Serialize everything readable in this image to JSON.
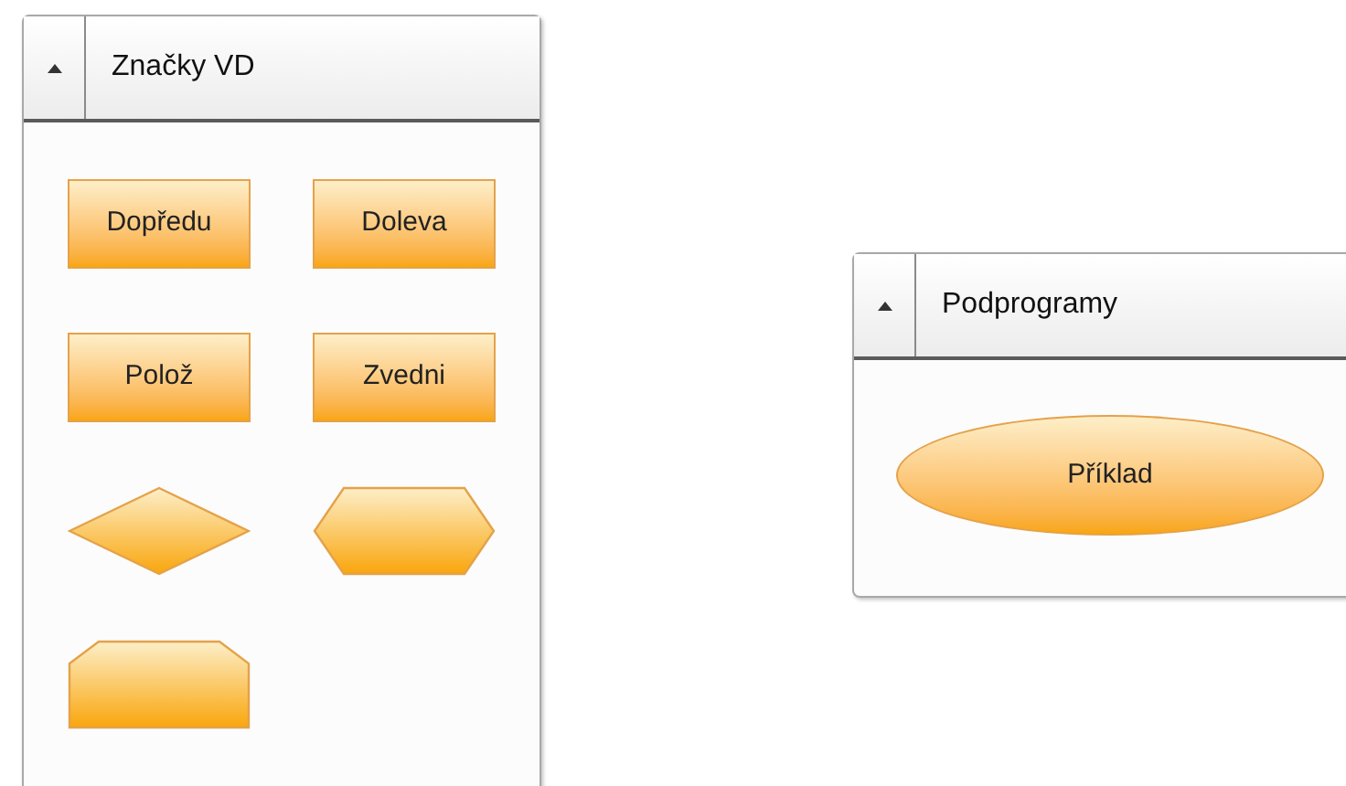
{
  "palettes": [
    {
      "title": "Značky VD",
      "expanded": true,
      "items": [
        {
          "kind": "rect",
          "label": "Dopředu"
        },
        {
          "kind": "rect",
          "label": "Doleva"
        },
        {
          "kind": "rect",
          "label": "Polož"
        },
        {
          "kind": "rect",
          "label": "Zvedni"
        },
        {
          "kind": "diamond"
        },
        {
          "kind": "hexagon"
        },
        {
          "kind": "tab"
        }
      ]
    },
    {
      "title": "Podprogramy",
      "expanded": true,
      "items": [
        {
          "kind": "ellipse",
          "label": "Příklad"
        }
      ]
    }
  ]
}
